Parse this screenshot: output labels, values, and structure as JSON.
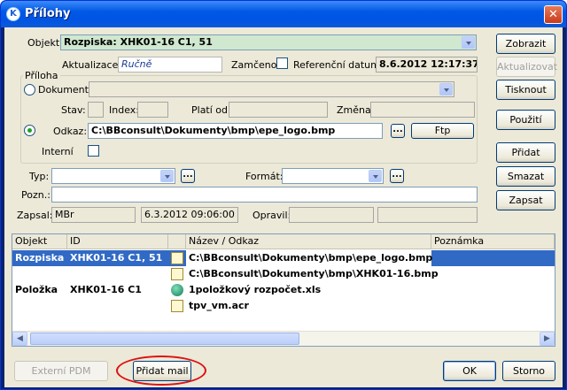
{
  "window": {
    "title": "Přílohy",
    "close": "✕",
    "app_icon": "K"
  },
  "objekt": {
    "label": "Objekt:",
    "value": "Rozpiska: XHK01-16 C1, 51"
  },
  "aktualizace": {
    "label": "Aktualizace:",
    "value": "Ručně"
  },
  "zamceno": {
    "label": "Zamčeno:",
    "checked": false
  },
  "ref_datum": {
    "label": "Referenční datum:",
    "value": "8.6.2012 12:17:37"
  },
  "priloha": {
    "group_label": "Příloha",
    "dokument_label": "Dokument:",
    "stav_label": "Stav:",
    "index_label": "Index:",
    "plati_od_label": "Platí od:",
    "zmena_label": "Změna:",
    "odkaz_label": "Odkaz:",
    "odkaz_value": "C:\\BBconsult\\Dokumenty\\bmp\\epe_logo.bmp",
    "ftp_button": "Ftp",
    "browse_button": "...",
    "interni_label": "Interní",
    "selected_option": "odkaz"
  },
  "typ": {
    "label": "Typ:",
    "value": ""
  },
  "format": {
    "label": "Formát:",
    "value": ""
  },
  "pozn": {
    "label": "Pozn.:",
    "value": ""
  },
  "zapsal": {
    "label": "Zapsal:",
    "user": "MBr",
    "date": "6.3.2012 09:06:00"
  },
  "opravil": {
    "label": "Opravil:",
    "user": "",
    "date": ""
  },
  "side_buttons": {
    "zobrazit": "Zobrazit",
    "aktualizovat": "Aktualizovat",
    "tisknout": "Tisknout",
    "pouziti": "Použití",
    "pridat": "Přidat",
    "smazat": "Smazat",
    "zapsat": "Zapsat"
  },
  "table": {
    "columns": [
      "Objekt",
      "ID",
      "",
      "Název / Odkaz",
      "Poznámka"
    ],
    "rows": [
      {
        "objekt": "Rozpiska",
        "id": "XHK01-16 C1, 51",
        "icon": "document-tree-icon",
        "nazev": "C:\\BBconsult\\Dokumenty\\bmp\\epe_logo.bmp",
        "poznamka": "",
        "selected": true
      },
      {
        "objekt": "",
        "id": "",
        "icon": "document-tree-icon",
        "nazev": "C:\\BBconsult\\Dokumenty\\bmp\\XHK01-16.bmp",
        "poznamka": "",
        "selected": false
      },
      {
        "objekt": "Položka",
        "id": "XHK01-16 C1",
        "icon": "globe-icon",
        "nazev": "1položkový rozpočet.xls",
        "poznamka": "",
        "selected": false
      },
      {
        "objekt": "",
        "id": "",
        "icon": "document-tree-icon",
        "nazev": "tpv_vm.acr",
        "poznamka": "",
        "selected": false
      }
    ]
  },
  "bottom_buttons": {
    "externi_pdm": "Externí PDM",
    "pridat_mail": "Přidat mail",
    "ok": "OK",
    "storno": "Storno"
  },
  "colors": {
    "accent": "#316ac5",
    "highlight_field": "#cfe8cf",
    "annotation": "#dd1111"
  }
}
